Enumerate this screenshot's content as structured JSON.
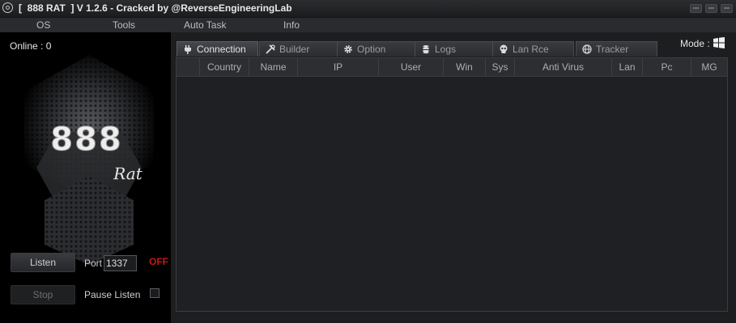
{
  "window": {
    "title": "[  888 RAT  ] V 1.2.6 - Cracked by @ReverseEngineeringLab"
  },
  "menu": [
    "OS",
    "Tools",
    "Auto Task",
    "Info"
  ],
  "left": {
    "online_label": "Online : 0",
    "logo_main": "888",
    "logo_sub": "Rat",
    "listen_label": "Listen",
    "port_label": "Port",
    "port_value": "1337",
    "status": "OFF",
    "stop_label": "Stop",
    "pause_label": "Pause Listen"
  },
  "tabs": [
    {
      "label": "Connection",
      "icon": "plug-icon"
    },
    {
      "label": "Builder",
      "icon": "tools-icon"
    },
    {
      "label": "Option",
      "icon": "gear-icon"
    },
    {
      "label": "Logs",
      "icon": "database-icon"
    },
    {
      "label": "Lan Rce",
      "icon": "skull-icon"
    },
    {
      "label": "Tracker",
      "icon": "globe-icon"
    }
  ],
  "mode_label": "Mode :",
  "table": {
    "columns": [
      "",
      "Country",
      "Name",
      "IP",
      "User",
      "Win",
      "Sys",
      "Anti Virus",
      "Lan",
      "Pc",
      "MG"
    ]
  },
  "colors": {
    "status_off": "#c21818",
    "background": "#1d1e20"
  }
}
